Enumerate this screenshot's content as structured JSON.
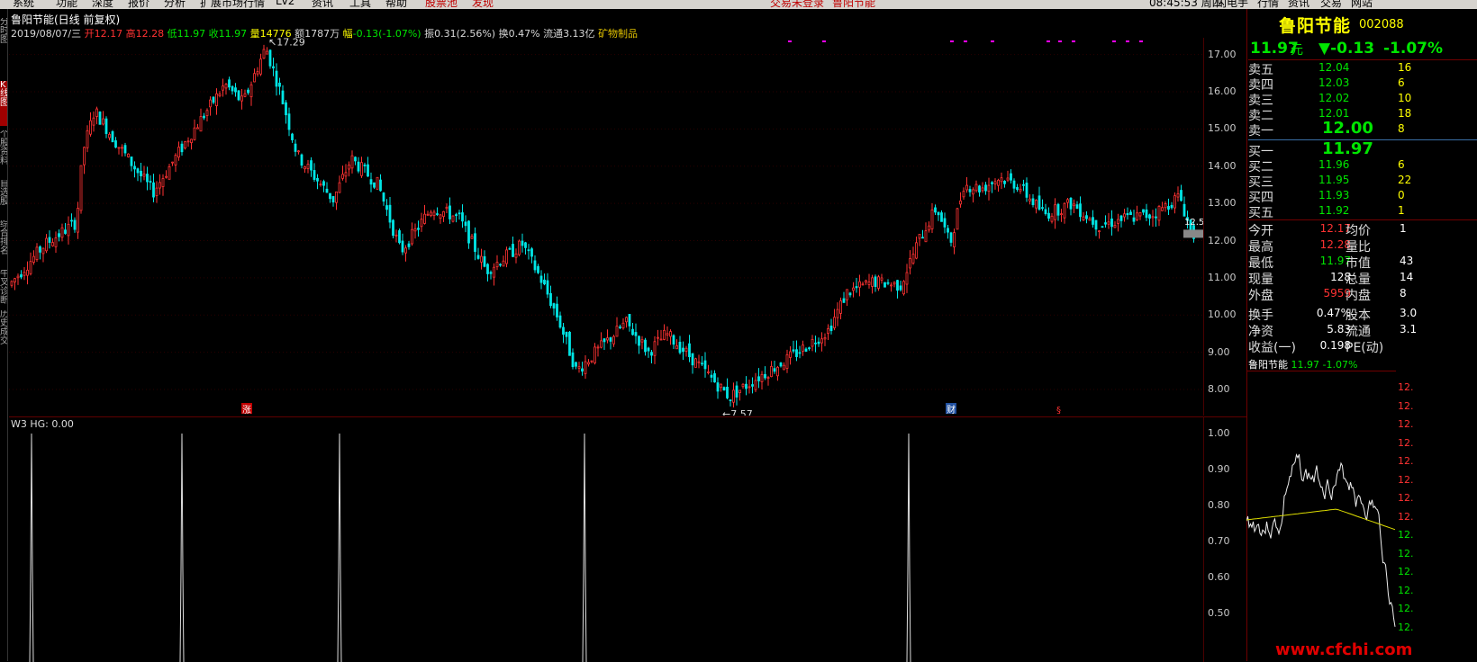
{
  "menu": {
    "items": [
      "系统",
      "功能",
      "深度",
      "报价",
      "分析",
      "扩展市场行情",
      "Lv2",
      "资讯",
      "工具",
      "帮助",
      "股票池",
      "发现"
    ],
    "status": [
      "交易未登录",
      "鲁阳节能"
    ],
    "right": [
      "08:45:53 周四",
      "闪电手",
      "行情",
      "资讯",
      "交易",
      "网站"
    ]
  },
  "left_toolbar": [
    "分时图",
    "K线图",
    "个股资料",
    "自选股",
    "综合排名",
    "牛叉诊断",
    "历史成交"
  ],
  "chart_header": {
    "title": "鲁阳节能(日线 前复权)",
    "date": "2019/08/07/三",
    "open_label": "开",
    "open": "12.17",
    "high_label": "高",
    "high": "12.28",
    "low_label": "低",
    "low": "11.97",
    "close_label": "收",
    "close": "11.97",
    "vol_label": "量",
    "vol": "14776",
    "amt_label": "额",
    "amt": "1787万",
    "chg_label": "幅",
    "chg": "-0.13(-1.07%)",
    "amp_label": "振",
    "amp": "0.31(2.56%)",
    "turn_label": "换",
    "turn": "0.47%",
    "float_label": "流通",
    "float": "3.13亿",
    "industry": "矿物制品"
  },
  "kchart": {
    "ylim": [
      7.3,
      17.45
    ],
    "y_ticks": [
      "17.00",
      "16.00",
      "15.00",
      "14.00",
      "13.00",
      "12.00",
      "11.00",
      "10.00",
      "9.00",
      "8.00"
    ],
    "high_marker": "17.29",
    "low_marker": "7.57",
    "last_price_tag": "12.5",
    "event_marks": [
      "涨",
      "财",
      "§"
    ]
  },
  "sub_indicator": {
    "header": "W3  HG: 0.00",
    "y_ticks": [
      "1.00",
      "0.90",
      "0.80",
      "0.70",
      "0.60",
      "0.50"
    ]
  },
  "right_panel": {
    "name": "鲁阳节能",
    "code": "002088",
    "price": "11.97",
    "unit": "元",
    "change": "▼-0.13",
    "pct": "-1.07%",
    "asks": [
      {
        "label": "卖五",
        "price": "12.04",
        "vol": "16"
      },
      {
        "label": "卖四",
        "price": "12.03",
        "vol": "6"
      },
      {
        "label": "卖三",
        "price": "12.02",
        "vol": "10"
      },
      {
        "label": "卖二",
        "price": "12.01",
        "vol": "18"
      },
      {
        "label": "卖一",
        "price": "12.00",
        "vol": "8"
      }
    ],
    "bids": [
      {
        "label": "买一",
        "price": "11.97",
        "vol": ""
      },
      {
        "label": "买二",
        "price": "11.96",
        "vol": "6"
      },
      {
        "label": "买三",
        "price": "11.95",
        "vol": "22"
      },
      {
        "label": "买四",
        "price": "11.93",
        "vol": "0"
      },
      {
        "label": "买五",
        "price": "11.92",
        "vol": "1"
      }
    ],
    "stats": [
      {
        "k1": "今开",
        "v1": "12.17",
        "c1": "up",
        "k2": "均价",
        "v2": "1"
      },
      {
        "k1": "最高",
        "v1": "12.28",
        "c1": "up",
        "k2": "量比",
        "v2": ""
      },
      {
        "k1": "最低",
        "v1": "11.97",
        "c1": "dn",
        "k2": "市值",
        "v2": "43"
      },
      {
        "k1": "现量",
        "v1": "128",
        "c1": "",
        "k2": "总量",
        "v2": "14"
      },
      {
        "k1": "外盘",
        "v1": "5959",
        "c1": "up",
        "k2": "内盘",
        "v2": "8"
      },
      {
        "k1": "换手",
        "v1": "0.47%",
        "c1": "",
        "k2": "股本",
        "v2": "3.0"
      },
      {
        "k1": "净资",
        "v1": "5.83",
        "c1": "",
        "k2": "流通",
        "v2": "3.1"
      },
      {
        "k1": "收益(一)",
        "v1": "0.198",
        "c1": "",
        "k2": "PE(动)",
        "v2": ""
      }
    ],
    "mini_header_name": "鲁阳节能",
    "mini_header_price": "11.97",
    "mini_header_pct": "-1.07%",
    "mini_axis": [
      "12.",
      "12.",
      "12.",
      "12.",
      "12.",
      "12.",
      "12.",
      "12.",
      "12.",
      "12.",
      "12.",
      "12.",
      "12.",
      "12."
    ]
  },
  "watermark": "www.cfchi.com",
  "colors": {
    "up": "#ff3232",
    "down": "#00e6e6",
    "grid": "#3a0000",
    "accent": "#ffff00"
  }
}
